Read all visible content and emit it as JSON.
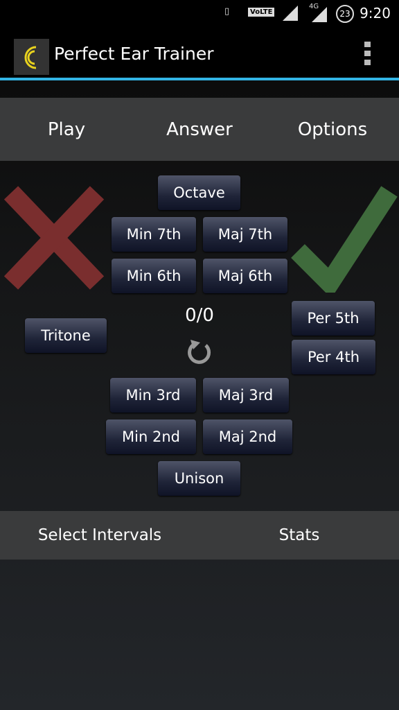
{
  "status": {
    "time": "9:20",
    "badge": "23",
    "network": "4G",
    "volte": "VoLTE"
  },
  "app": {
    "title": "Perfect Ear Trainer",
    "logo_color": "#e8d21e",
    "accent": "#33b5e5"
  },
  "tabs": [
    "Play",
    "Answer",
    "Options"
  ],
  "intervals": {
    "octave": "Octave",
    "min7": "Min 7th",
    "maj7": "Maj 7th",
    "min6": "Min 6th",
    "maj6": "Maj 6th",
    "tritone": "Tritone",
    "per5": "Per 5th",
    "per4": "Per 4th",
    "min3": "Min 3rd",
    "maj3": "Maj 3rd",
    "min2": "Min 2nd",
    "maj2": "Maj 2nd",
    "unison": "Unison"
  },
  "score": "0/0",
  "indicators": {
    "wrong_color": "#7a2e2e",
    "right_color": "#3f6b3c"
  },
  "bottom": [
    "Select Intervals",
    "Stats"
  ]
}
